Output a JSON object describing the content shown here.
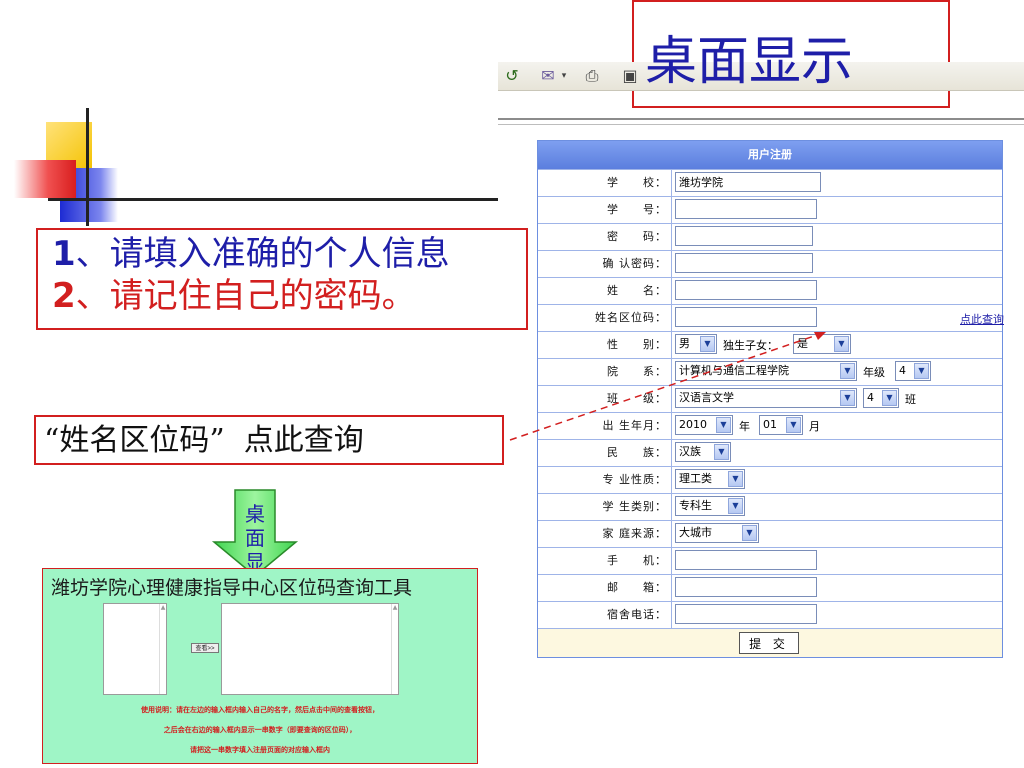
{
  "title": "桌面显示",
  "toolbar": {
    "icons": [
      "back-icon",
      "mail-icon",
      "print-icon",
      "edit-icon"
    ]
  },
  "instructions": {
    "line1_num": "1",
    "line1_text": "、请填入准确的个人信息",
    "line2_num": "2",
    "line2_text": "、请记住自己的密码。"
  },
  "query_note": "“姓名区位码”  点此查询",
  "arrow_label": "桌面显示",
  "tool": {
    "title": "潍坊学院心理健康指导中心区位码查询工具",
    "button_label": "查看>>",
    "notes": [
      "使用说明：请在左边的输入框内输入自己的名字，然后点击中间的查看按钮，",
      "之后会在右边的输入框内显示一串数字（即要查询的区位码），",
      "请把这一串数字填入注册页面的对应输入框内"
    ]
  },
  "form": {
    "header": "用户注册",
    "labels": {
      "school": "学　　校：",
      "student_id": "学　　号：",
      "password": "密　　码：",
      "confirm": "确 认密码：",
      "name": "姓　　名：",
      "name_code": "姓名区位码：",
      "gender": "性　　别：",
      "dept": "院　　系：",
      "class": "班　　级：",
      "birth": "出 生年月：",
      "ethnic": "民　　族：",
      "major_type": "专 业性质：",
      "student_type": "学 生类别：",
      "origin": "家 庭来源：",
      "mobile": "手　　机：",
      "email": "邮　　箱：",
      "dorm_phone": "宿舍电话："
    },
    "values": {
      "school": "潍坊学院",
      "gender": "男",
      "only_child_label": "独生子女：",
      "only_child": "是",
      "dept": "计算机与通信工程学院",
      "grade_label": "年级",
      "grade": "4",
      "class_major": "汉语言文学",
      "class_no": "4",
      "class_suffix": "班",
      "year": "2010",
      "year_suffix": "年",
      "month": "01",
      "month_suffix": "月",
      "ethnic": "汉族",
      "major_type": "理工类",
      "student_type": "专科生",
      "origin": "大城市"
    },
    "lookup_link": "点此查询",
    "submit": "提 交"
  }
}
